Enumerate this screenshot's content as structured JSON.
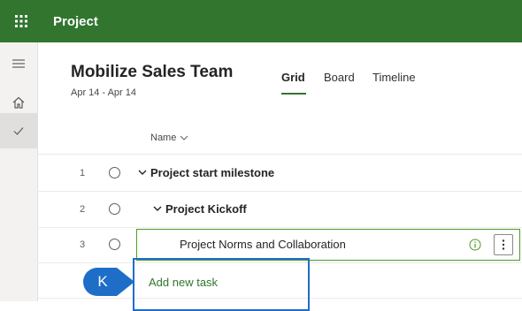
{
  "app": {
    "title": "Project"
  },
  "rail": {
    "items": [
      "menu",
      "home",
      "check"
    ]
  },
  "plan": {
    "title": "Mobilize Sales Team",
    "dates": "Apr 14 - Apr 14"
  },
  "tabs": [
    {
      "label": "Grid",
      "active": true
    },
    {
      "label": "Board",
      "active": false
    },
    {
      "label": "Timeline",
      "active": false
    }
  ],
  "grid": {
    "name_header": "Name",
    "rows": [
      {
        "num": "1",
        "title": "Project start milestone",
        "bold": true,
        "expandable": true
      },
      {
        "num": "2",
        "title": "Project Kickoff",
        "bold": true,
        "expandable": true
      },
      {
        "num": "3",
        "title": "Project Norms and Collaboration",
        "bold": false,
        "expandable": false
      }
    ],
    "add_task": "Add new task"
  },
  "callout": {
    "label": "K",
    "color": "#1e6ec8"
  },
  "colors": {
    "brand": "#31752f",
    "selection": "#4c9a2a",
    "callout_border": "#1e6ec8"
  }
}
